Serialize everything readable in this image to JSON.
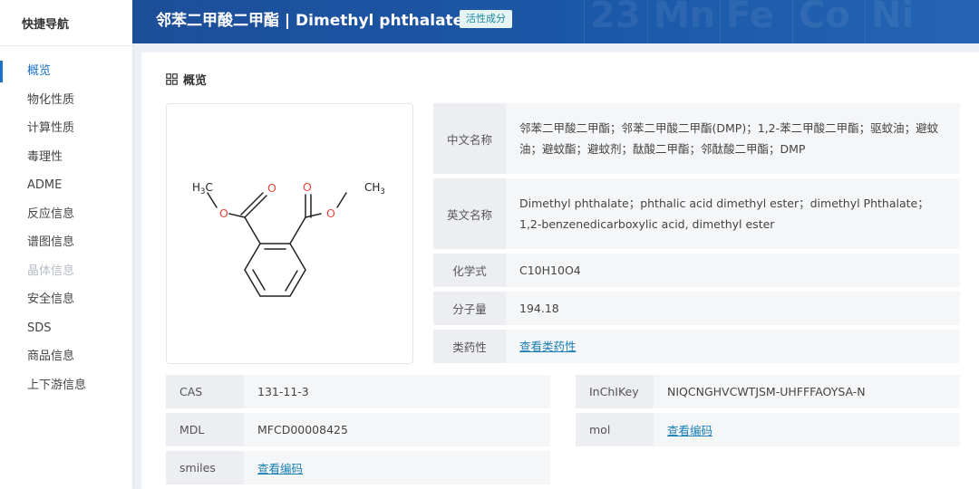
{
  "sidebar": {
    "title": "快捷导航",
    "items": [
      {
        "label": "概览"
      },
      {
        "label": "物化性质"
      },
      {
        "label": "计算性质"
      },
      {
        "label": "毒理性"
      },
      {
        "label": "ADME"
      },
      {
        "label": "反应信息"
      },
      {
        "label": "谱图信息"
      },
      {
        "label": "晶体信息"
      },
      {
        "label": "安全信息"
      },
      {
        "label": "SDS"
      },
      {
        "label": "商品信息"
      },
      {
        "label": "上下游信息"
      }
    ]
  },
  "header": {
    "title": "邻苯二甲酸二甲酯 | Dimethyl phthalate",
    "tag": "活性成分",
    "deco": [
      "23",
      "Mn",
      "Fe",
      "Co",
      "Ni"
    ]
  },
  "overview": {
    "title": "概览",
    "structure_labels": {
      "o": "O",
      "h3c": "H3C",
      "h3c_sub_h": "H",
      "h3c_sub_3": "3",
      "h3c_sub_c": "C",
      "ch3_c": "CH",
      "ch3_3": "3"
    },
    "info": [
      {
        "label": "中文名称",
        "value": "邻苯二甲酸二甲酯；邻苯二甲酸二甲酯(DMP)；1,2-苯二甲酸二甲酯；驱蚊油；避蚊油；避蚊酯；避蚊剂；酞酸二甲酯；邻酞酸二甲酯；DMP"
      },
      {
        "label": "英文名称",
        "value": "Dimethyl phthalate；phthalic acid dimethyl ester；dimethyl Phthalate；1,2-benzenedicarboxylic acid, dimethyl ester"
      },
      {
        "label": "化学式",
        "value": "C10H10O4"
      },
      {
        "label": "分子量",
        "value": "194.18"
      },
      {
        "label": "类药性",
        "value": "查看类药性"
      }
    ],
    "identifiers": {
      "cas": {
        "label": "CAS",
        "value": "131-11-3"
      },
      "mdl": {
        "label": "MDL",
        "value": "MFCD00008425"
      },
      "smiles": {
        "label": "smiles",
        "value": "查看编码"
      },
      "inchikey": {
        "label": "InChIKey",
        "value": "NIQCNGHVCWTJSM-UHFFFAOYSA-N"
      },
      "mol": {
        "label": "mol",
        "value": "查看编码"
      }
    }
  },
  "colors": {
    "header": "#1d4e98",
    "accent": "#1a73c9",
    "link": "#1a7fb5",
    "oxygen": "#e8443a"
  }
}
